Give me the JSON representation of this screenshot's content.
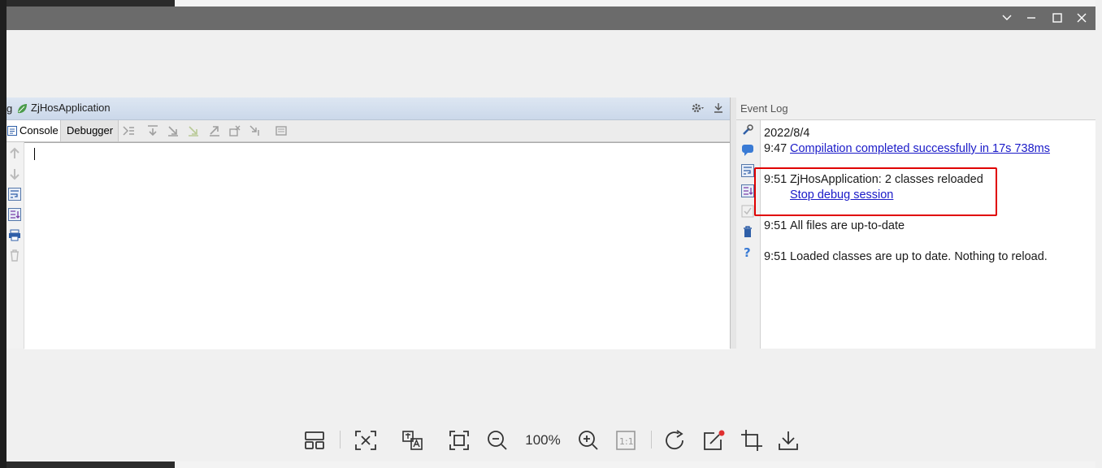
{
  "run_panel": {
    "left_cut": "g",
    "app_name": "ZjHosApplication",
    "tabs": [
      {
        "label": "Console"
      },
      {
        "label": "Debugger"
      }
    ]
  },
  "event_log": {
    "title": "Event Log",
    "date": "2022/8/4",
    "entries": [
      {
        "time": "9:47",
        "text": "Compilation completed successfully in 17s 738ms"
      },
      {
        "time": "9:51",
        "text": "ZjHosApplication: 2 classes reloaded",
        "link": "Stop debug session"
      },
      {
        "time": "9:51",
        "text": "All files are up-to-date"
      },
      {
        "time": "9:51",
        "text": "Loaded classes are up to date. Nothing to reload."
      }
    ]
  },
  "viewer_toolbar": {
    "zoom": "100%",
    "one_to_one": "1:1"
  },
  "colors": {
    "titlebar": "#6b6b6b",
    "highlight": "#e00000",
    "link": "#1a1ac8"
  }
}
